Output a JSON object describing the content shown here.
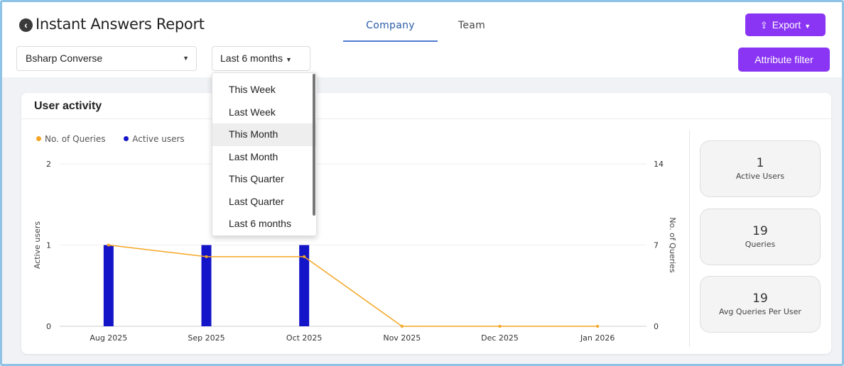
{
  "header": {
    "title": "Instant Answers Report",
    "tabs": [
      {
        "label": "Company",
        "active": true
      },
      {
        "label": "Team",
        "active": false
      }
    ],
    "export_label": "Export"
  },
  "filters": {
    "app_selected": "Bsharp Converse",
    "range_selected": "Last 6 months",
    "attribute_filter_label": "Attribute filter"
  },
  "range_dropdown": {
    "options": [
      "This Week",
      "Last Week",
      "This Month",
      "Last Month",
      "This Quarter",
      "Last Quarter",
      "Last 6 months"
    ],
    "highlighted": "This Month"
  },
  "card": {
    "title": "User activity"
  },
  "stats": [
    {
      "value": "1",
      "label": "Active Users"
    },
    {
      "value": "19",
      "label": "Queries"
    },
    {
      "value": "19",
      "label": "Avg Queries Per User"
    }
  ],
  "colors": {
    "accent": "#8a35f3",
    "queries_line": "#f5a623",
    "active_bars": "#1414c8",
    "tab_active": "#2b5da8"
  },
  "chart_data": {
    "type": "bar",
    "categories": [
      "Aug 2025",
      "Sep 2025",
      "Oct 2025",
      "Nov 2025",
      "Dec 2025",
      "Jan 2026"
    ],
    "series": [
      {
        "name": "Active users",
        "type": "bar",
        "axis": "left",
        "values": [
          1,
          1,
          1,
          0,
          0,
          0
        ]
      },
      {
        "name": "No. of Queries",
        "type": "line",
        "axis": "right",
        "values": [
          7,
          6,
          6,
          0,
          0,
          0
        ]
      }
    ],
    "ylabel": "Active users",
    "ylabel_right": "No. of Queries",
    "ylim": [
      0,
      2
    ],
    "ylim_right": [
      0,
      14
    ],
    "yticks": [
      "0",
      "1",
      "2"
    ],
    "yticks_right": [
      "0",
      "7",
      "14"
    ],
    "grid": true,
    "legend": "top-left"
  }
}
